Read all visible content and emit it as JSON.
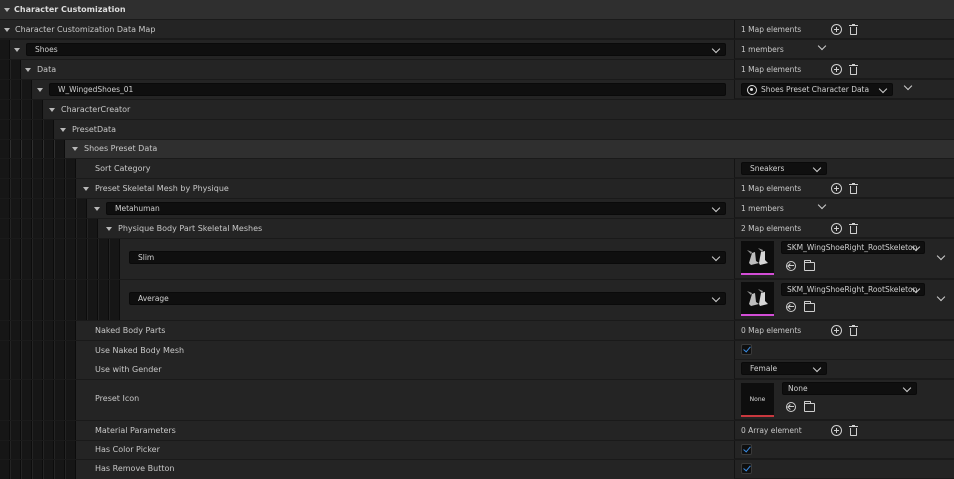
{
  "header": {
    "title": "Character Customization"
  },
  "map": {
    "label": "Character Customization Data Map",
    "count": "1 Map elements"
  },
  "shoes": {
    "key": "Shoes",
    "count": "1 members"
  },
  "data": {
    "label": "Data",
    "count": "1 Map elements"
  },
  "asset": {
    "key": "W_WingedShoes_01",
    "class_label": "Shoes Preset Character Data"
  },
  "creator": {
    "label": "CharacterCreator"
  },
  "preset_data": {
    "label": "PresetData"
  },
  "shoes_preset": {
    "label": "Shoes Preset Data"
  },
  "sort_category": {
    "label": "Sort Category",
    "value": "Sneakers"
  },
  "skeletal_by_physique": {
    "label": "Preset Skeletal Mesh by Physique",
    "count": "1 Map elements"
  },
  "metahuman": {
    "key": "Metahuman",
    "count": "1 members"
  },
  "body_part_meshes": {
    "label": "Physique Body Part Skeletal Meshes",
    "count": "2 Map elements"
  },
  "slim": {
    "key": "Slim",
    "mesh": "SKM_WingShoeRight_RootSkeleton"
  },
  "average": {
    "key": "Average",
    "mesh": "SKM_WingShoeRight_RootSkeleton"
  },
  "naked_body_parts": {
    "label": "Naked Body Parts",
    "count": "0 Map elements"
  },
  "use_naked_body_mesh": {
    "label": "Use Naked Body Mesh",
    "checked": true
  },
  "use_with_gender": {
    "label": "Use with Gender",
    "value": "Female"
  },
  "preset_icon": {
    "label": "Preset Icon",
    "thumb_text": "None",
    "value": "None"
  },
  "material_parameters": {
    "label": "Material Parameters",
    "count": "0 Array element"
  },
  "has_color_picker": {
    "label": "Has Color Picker",
    "checked": true
  },
  "has_remove_button": {
    "label": "Has Remove Button",
    "checked": true
  },
  "colors": {
    "accent_check": "#3b8fe8",
    "mesh_thumb_underline": "#d24dd6",
    "none_thumb_underline": "#c8383e",
    "background": "#242424",
    "header": "#2f2f2f"
  }
}
